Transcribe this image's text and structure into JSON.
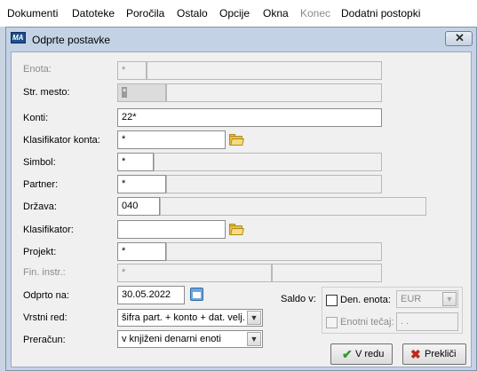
{
  "menu": [
    "Dokumenti",
    "Datoteke",
    "Poročila",
    "Ostalo",
    "Opcije",
    "Okna",
    "Konec",
    "Dodatni postopki"
  ],
  "dialog": {
    "title": "Odprte postavke",
    "app_icon_text": "MA",
    "close_glyph": "✕"
  },
  "form": {
    "enota": {
      "label": "Enota:",
      "code": "*",
      "name": ""
    },
    "str_mesto": {
      "label": "Str. mesto:",
      "code": "*",
      "name": ""
    },
    "konti": {
      "label": "Konti:",
      "value": "22*"
    },
    "klasifikator_konta": {
      "label": "Klasifikator konta:",
      "value": "*"
    },
    "simbol": {
      "label": "Simbol:",
      "code": "*",
      "name": ""
    },
    "partner": {
      "label": "Partner:",
      "code": "*",
      "name": ""
    },
    "drzava": {
      "label": "Država:",
      "code": "040",
      "name": ""
    },
    "klasifikator": {
      "label": "Klasifikator:",
      "value": ""
    },
    "projekt": {
      "label": "Projekt:",
      "code": "*",
      "name": ""
    },
    "fin_instr": {
      "label": "Fin. instr.:",
      "code": "*",
      "name": ""
    },
    "odprto_na": {
      "label": "Odprto na:",
      "value": "30.05.2022"
    },
    "vrstni_red": {
      "label": "Vrstni red:",
      "value": "šifra part. + konto + dat. velj. + d"
    },
    "preracun": {
      "label": "Preračun:",
      "value": "v knjiženi denarni enoti"
    }
  },
  "saldo": {
    "label": "Saldo v:",
    "den_enota_label": "Den. enota:",
    "den_enota_value": "EUR",
    "enotni_tecaj_label": "Enotni tečaj:",
    "enotni_tecaj_value": ". ."
  },
  "buttons": {
    "ok": "V redu",
    "cancel": "Prekliči"
  },
  "colors": {
    "ok_check": "#2e9a2e",
    "cancel_x": "#c0281e"
  }
}
